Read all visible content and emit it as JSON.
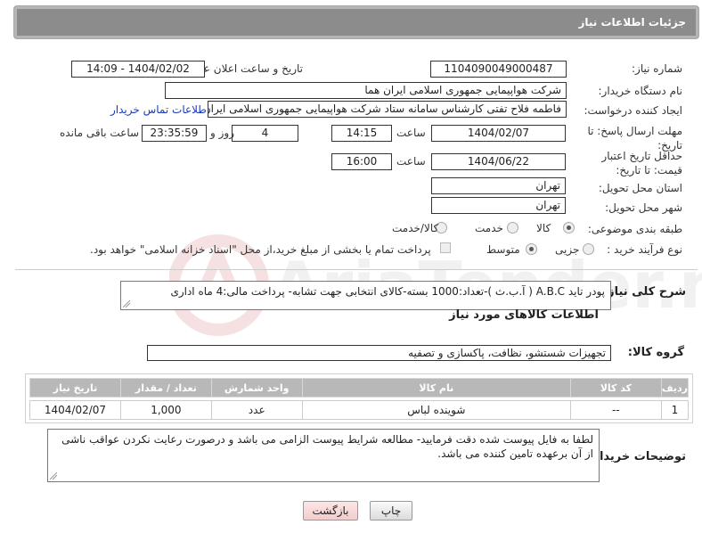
{
  "header": {
    "title": "جزئیات اطلاعات نیاز"
  },
  "form": {
    "need_number_label": "شماره نیاز:",
    "need_number": "1104090049000487",
    "announce_label": "تاریخ و ساعت اعلان عمومی:",
    "announce_value": "1404/02/02 - 14:09",
    "buyer_org_label": "نام دستگاه خریدار:",
    "buyer_org": "شرکت هواپیمایی جمهوری اسلامی ایران هما",
    "creator_label": "ایجاد کننده درخواست:",
    "creator": "فاطمه فلاح تفتی کارشناس سامانه ستاد شرکت هواپیمایی جمهوری اسلامی ایران",
    "contact_link": "اطلاعات تماس خریدار",
    "reply_deadline_label": "مهلت ارسال پاسخ: تا تاریخ:",
    "reply_date": "1404/02/07",
    "time_label": "ساعت",
    "reply_time": "14:15",
    "days_value": "4",
    "days_label": "روز و",
    "remaining_time": "23:35:59",
    "remaining_label": "ساعت باقی مانده",
    "price_validity_label": "حداقل تاریخ اعتبار قیمت: تا تاریخ:",
    "price_date": "1404/06/22",
    "price_time": "16:00",
    "province_label": "استان محل تحویل:",
    "province": "تهران",
    "city_label": "شهر محل تحویل:",
    "city": "تهران",
    "category_label": "طبقه بندی موضوعی:",
    "category_options": [
      "کالا",
      "خدمت",
      "کالا/خدمت"
    ],
    "process_label": "نوع فرآیند خرید :",
    "process_options": [
      "جزیی",
      "متوسط"
    ],
    "payment_note": "پرداخت تمام یا بخشی از مبلغ خرید،از محل \"اسناد خزانه اسلامی\" خواهد بود."
  },
  "description": {
    "label": "شرح کلی نیاز:",
    "text": "پودر تاید A.B.C ( آ.ب.ث )-تعداد:1000 بسته-کالای انتخابی جهت تشابه- پرداخت مالی:4 ماه اداری"
  },
  "goods": {
    "section_title": "اطلاعات کالاهای مورد نیاز",
    "group_label": "گروه کالا:",
    "group_value": "تجهیزات شستشو، نظافت، پاکسازی و تصفیه",
    "columns": [
      "ردیف",
      "کد کالا",
      "نام کالا",
      "واحد شمارش",
      "تعداد / مقدار",
      "تاریخ نیاز"
    ],
    "rows": [
      [
        "1",
        "--",
        "شوینده لباس",
        "عدد",
        "1,000",
        "1404/02/07"
      ]
    ]
  },
  "buyer_notes": {
    "label": "توضیحات خریدار:",
    "text": "لطفا به فایل پیوست شده دقت فرمایید- مطالعه شرایط پیوست الزامی می باشد و درصورت رعایت نکردن عواقب ناشی از آن برعهده تامین کننده می باشد."
  },
  "buttons": {
    "print": "چاپ",
    "back": "بازگشت"
  },
  "watermark": {
    "text": "AriaTender.neT"
  },
  "colors": {
    "header_bg": "#8c8c8c",
    "link": "#1a3bb8",
    "table_header": "#b8b8b8",
    "back_button_bg": "#f7d6d6"
  }
}
